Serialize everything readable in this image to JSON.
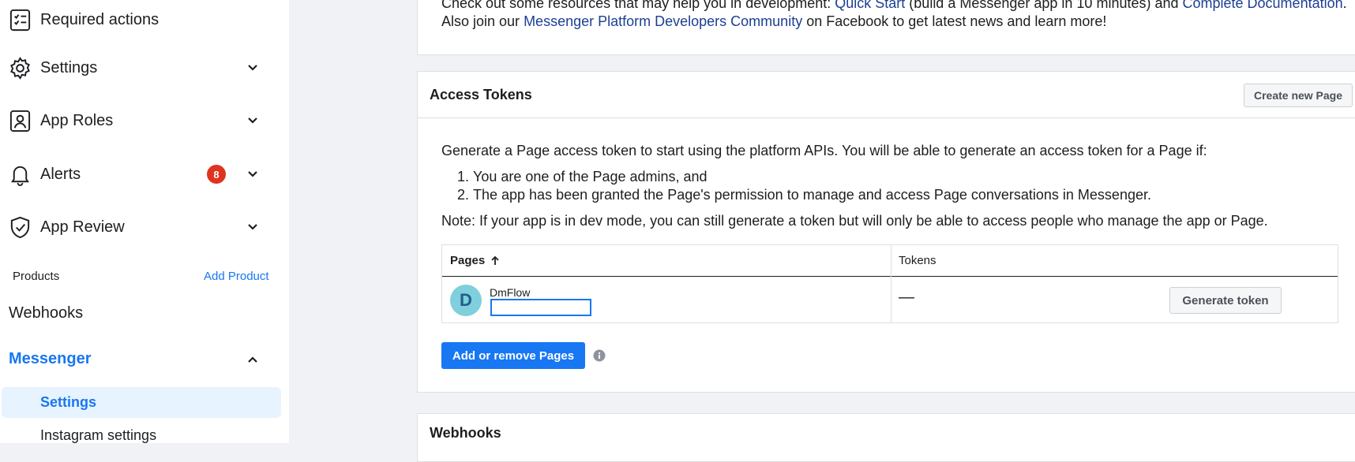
{
  "sidebar": {
    "items": [
      {
        "label": "Required actions",
        "icon": "checklist-icon"
      },
      {
        "label": "Settings",
        "icon": "gear-icon"
      },
      {
        "label": "App Roles",
        "icon": "id-badge-icon"
      },
      {
        "label": "Alerts",
        "icon": "bell-icon",
        "badge": "8"
      },
      {
        "label": "App Review",
        "icon": "shield-check-icon"
      }
    ],
    "products_label": "Products",
    "add_product": "Add Product",
    "webhooks": "Webhooks",
    "messenger": "Messenger",
    "messenger_sub": [
      "Settings",
      "Instagram settings"
    ]
  },
  "intro": {
    "line1_before": "Check out some resources that may help you in development: ",
    "line1_link1": "Quick Start",
    "line1_mid": " (build a Messenger app in 10 minutes) and ",
    "line1_link2": "Complete Documentation",
    "line1_after": ".",
    "line2_before": "Also join our ",
    "line2_link": "Messenger Platform Developers Community",
    "line2_after": " on Facebook to get latest news and learn more!"
  },
  "tokens": {
    "title": "Access Tokens",
    "create_button": "Create new Page",
    "description": "Generate a Page access token to start using the platform APIs. You will be able to generate an access token for a Page if:",
    "conditions": [
      {
        "num": "1.",
        "text": "You are one of the Page admins, and"
      },
      {
        "num": "2.",
        "text": "The app has been granted the Page's permission to manage and access Page conversations in Messenger."
      }
    ],
    "note": "Note: If your app is in dev mode, you can still generate a token but will only be able to access people who manage the app or Page.",
    "table": {
      "col_pages": "Pages",
      "col_tokens": "Tokens",
      "row": {
        "avatar_letter": "D",
        "page_name": "DmFlow",
        "input_value": "",
        "token": "—",
        "button": "Generate token"
      }
    },
    "add_remove_button": "Add or remove Pages"
  },
  "webhooks_panel": {
    "title": "Webhooks"
  },
  "colors": {
    "accent": "#1877f2",
    "badge": "#e0331e",
    "link": "#1c3f94",
    "background": "#f0f2f5"
  }
}
